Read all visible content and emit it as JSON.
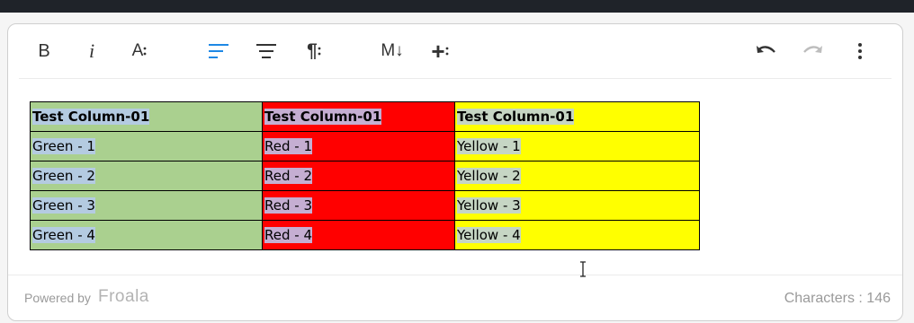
{
  "colors": {
    "accent": "#1e88e5",
    "green": "#aad08f",
    "red": "#ff0000",
    "yellow": "#ffff00"
  },
  "toolbar": {
    "bold_label": "B",
    "italic_label": "i",
    "font_size_label": "A",
    "paragraph_label": "¶",
    "markdown_label": "M↓",
    "insert_label": "+"
  },
  "table": {
    "headers": [
      "Test Column-01",
      "Test Column-01",
      "Test Column-01"
    ],
    "rows": [
      [
        "Green - 1",
        "Red - 1",
        "Yellow - 1"
      ],
      [
        "Green - 2",
        "Red - 2",
        "Yellow - 2"
      ],
      [
        "Green - 3",
        "Red - 3",
        "Yellow - 3"
      ],
      [
        "Green - 4",
        "Red - 4",
        "Yellow - 4"
      ]
    ]
  },
  "footer": {
    "powered_by": "Powered by",
    "brand": "Froala",
    "characters": "Characters : 146"
  }
}
